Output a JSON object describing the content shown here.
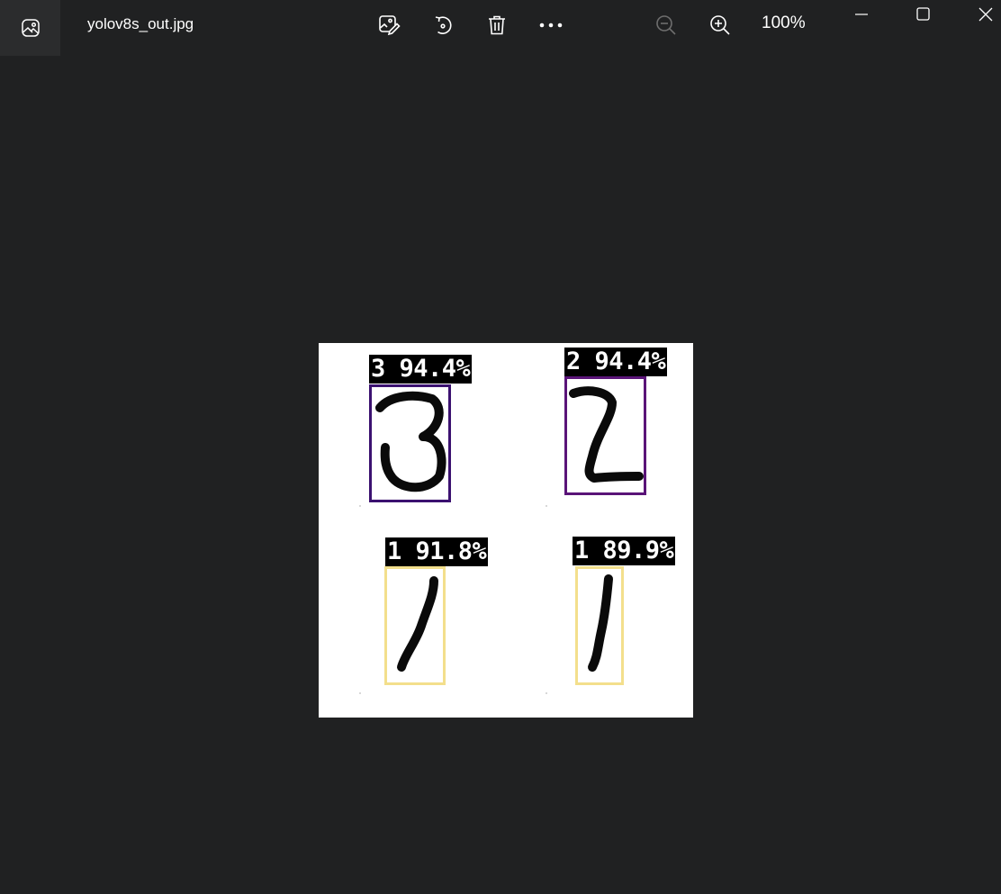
{
  "window": {
    "filename": "yolov8s_out.jpg",
    "zoom": "100%"
  },
  "toolbar": {
    "icons": [
      "edit-image-icon",
      "rotate-icon",
      "delete-icon",
      "more-icon",
      "zoom-out-icon",
      "zoom-in-icon"
    ]
  },
  "detections": [
    {
      "class": "3",
      "confidence": "94.4%",
      "label": "3 94.4%",
      "color": "#3b1170"
    },
    {
      "class": "2",
      "confidence": "94.4%",
      "label": "2 94.4%",
      "color": "#5a1478"
    },
    {
      "class": "1",
      "confidence": "91.8%",
      "label": "1 91.8%",
      "color": "#f3df8c"
    },
    {
      "class": "1",
      "confidence": "89.9%",
      "label": "1 89.9%",
      "color": "#f3df8c"
    }
  ]
}
